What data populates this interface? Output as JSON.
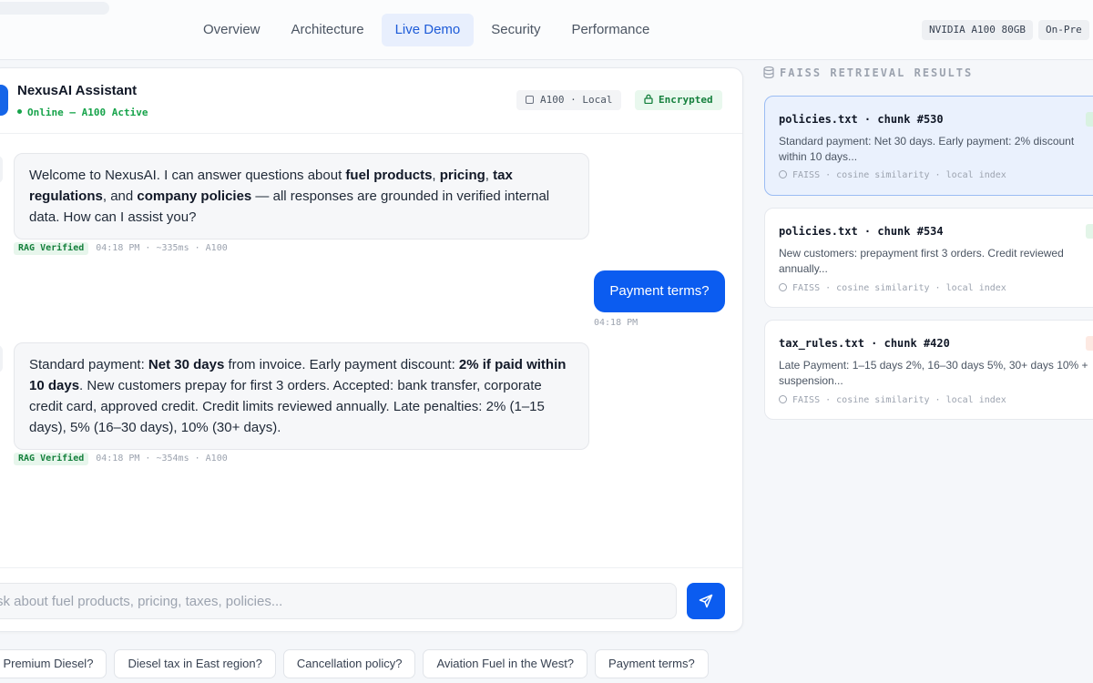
{
  "nav": {
    "tabs": [
      {
        "label": "Overview"
      },
      {
        "label": "Architecture"
      },
      {
        "label": "Live Demo"
      },
      {
        "label": "Security"
      },
      {
        "label": "Performance"
      }
    ],
    "active_tab": "Live Demo",
    "hardware_badges": [
      "NVIDIA A100 80GB",
      "On-Pre"
    ]
  },
  "chat": {
    "assistant_name": "NexusAI Assistant",
    "status": "Online — A100 Active",
    "gpu_badge": "A100 · Local",
    "encryption_badge": "Encrypted",
    "messages": [
      {
        "role": "assistant",
        "segments": [
          {
            "text": "Welcome to NexusAI. I can answer questions about ",
            "bold": false
          },
          {
            "text": "fuel products",
            "bold": true
          },
          {
            "text": ", ",
            "bold": false
          },
          {
            "text": "pricing",
            "bold": true
          },
          {
            "text": ", ",
            "bold": false
          },
          {
            "text": "tax regulations",
            "bold": true
          },
          {
            "text": ", and ",
            "bold": false
          },
          {
            "text": "company policies",
            "bold": true
          },
          {
            "text": " — all responses are grounded in verified internal data. How can I assist you?",
            "bold": false
          }
        ],
        "badge": "RAG Verified",
        "meta": "04:18 PM · ~335ms · A100"
      },
      {
        "role": "user",
        "text": "Payment terms?",
        "time": "04:18 PM"
      },
      {
        "role": "assistant",
        "segments": [
          {
            "text": "Standard payment: ",
            "bold": false
          },
          {
            "text": "Net 30 days",
            "bold": true
          },
          {
            "text": " from invoice. Early payment discount: ",
            "bold": false
          },
          {
            "text": "2% if paid within 10 days",
            "bold": true
          },
          {
            "text": ". New customers prepay for first 3 orders. Accepted: bank transfer, corporate credit card, approved credit. Credit limits reviewed annually. Late penalties: 2% (1–15 days), 5% (16–30 days), 10% (30+ days).",
            "bold": false
          }
        ],
        "badge": "RAG Verified",
        "meta": "04:18 PM · ~354ms · A100"
      }
    ],
    "input": {
      "placeholder": "sk about fuel products, pricing, taxes, policies...",
      "value": ""
    }
  },
  "suggestions": [
    "of Premium Diesel?",
    "Diesel tax in East region?",
    "Cancellation policy?",
    "Aviation Fuel in the West?",
    "Payment terms?"
  ],
  "retrieval": {
    "title": "FAISS RETRIEVAL RESULTS",
    "results": [
      {
        "title": "policies.txt · chunk #530",
        "snippet": "Standard payment: Net 30 days. Early payment: 2% discount within 10 days...",
        "meta": "FAISS · cosine similarity · local index",
        "score_color": "#d9f2e1",
        "active": true
      },
      {
        "title": "policies.txt · chunk #534",
        "snippet": "New customers: prepayment first 3 orders. Credit reviewed annually...",
        "meta": "FAISS · cosine similarity · local index",
        "score_color": "#e3f5e8",
        "active": false
      },
      {
        "title": "tax_rules.txt · chunk #420",
        "snippet": "Late Payment: 1–15 days 2%, 16–30 days 5%, 30+ days 10% + suspension...",
        "meta": "FAISS · cosine similarity · local index",
        "score_color": "#fde9e2",
        "active": false
      }
    ]
  },
  "colors": {
    "accent": "#0b5cf0",
    "success": "#15803d"
  }
}
